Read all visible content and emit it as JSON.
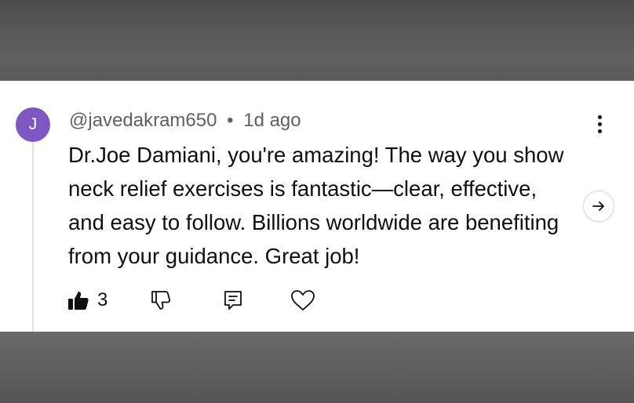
{
  "comment": {
    "avatar_letter": "J",
    "username": "@javedakram650",
    "separator": "•",
    "time": "1d ago",
    "text": "Dr.Joe Damiani, you're amazing! The way you show neck relief exercises is fantastic—clear, effective, and easy to follow. Billions worldwide are benefiting from your guidance. Great job!",
    "like_count": "3"
  },
  "icons": {
    "like": "thumbs-up-icon",
    "dislike": "thumbs-down-icon",
    "reply": "reply-icon",
    "heart": "heart-icon",
    "more": "more-vert-icon",
    "next": "arrow-right-icon"
  },
  "colors": {
    "avatar": "#7e57c2",
    "text": "#0f0f0f",
    "meta": "#606060",
    "backdrop": "#5f5f5f"
  }
}
